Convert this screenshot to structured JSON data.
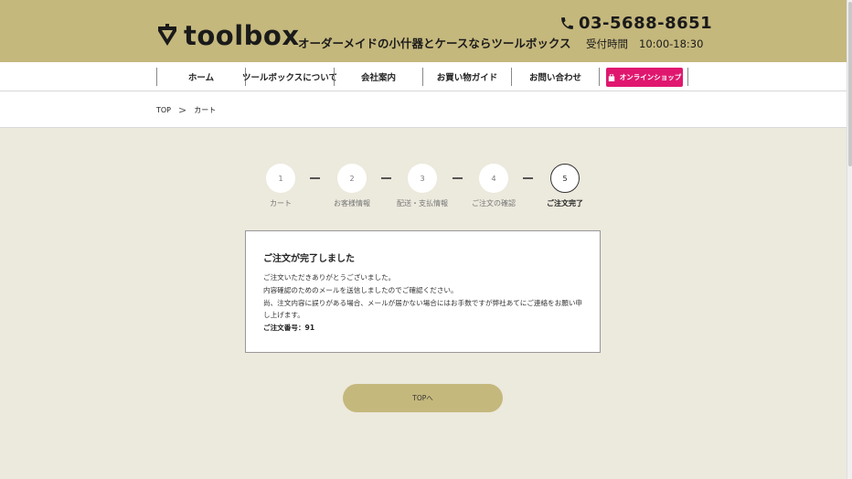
{
  "header": {
    "logo_text": "toolbox",
    "tagline": "オーダーメイドの小什器とケースならツールボックス",
    "phone": "03-5688-8651",
    "hours_label": "受付時間",
    "hours_value": "10:00-18:30"
  },
  "nav": {
    "items": [
      {
        "label": "ホーム"
      },
      {
        "label": "ツールボックスについて"
      },
      {
        "label": "会社案内"
      },
      {
        "label": "お買い物ガイド"
      },
      {
        "label": "お問い合わせ"
      }
    ],
    "shop_label": "オンラインショップ",
    "shop_color": "#e0176f"
  },
  "breadcrumb": {
    "items": [
      "TOP",
      "カート"
    ]
  },
  "steps": [
    {
      "num": "1",
      "label": "カート"
    },
    {
      "num": "2",
      "label": "お客様情報"
    },
    {
      "num": "3",
      "label": "配送・支払情報"
    },
    {
      "num": "4",
      "label": "ご注文の確認"
    },
    {
      "num": "5",
      "label": "ご注文完了",
      "active": true
    }
  ],
  "complete": {
    "title": "ご注文が完了しました",
    "line1": "ご注文いただきありがとうございました。",
    "line2": "内容確認のためのメールを送信しましたのでご確認ください。",
    "line3": "尚、注文内容に誤りがある場合、メールが届かない場合にはお手数ですが弊社あてにご連絡をお願い申し上げます。",
    "order_label": "ご注文番号：91"
  },
  "top_button": "TOPへ",
  "colors": {
    "header_bg": "#c5b87d",
    "page_bg": "#ece9dd",
    "accent": "#e0176f"
  }
}
